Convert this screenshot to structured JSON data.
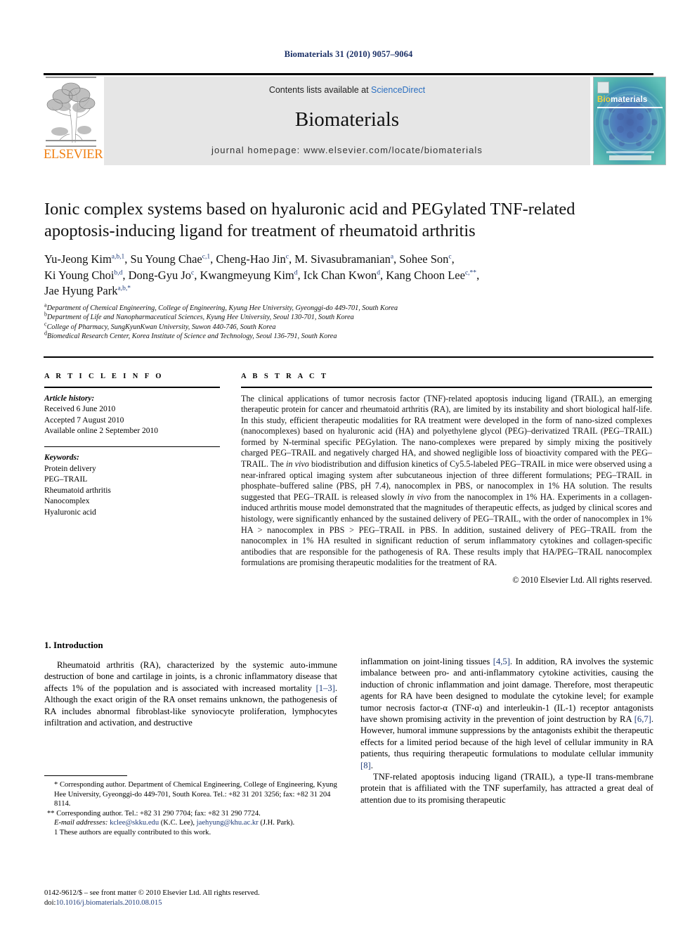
{
  "running_head": "Biomaterials 31 (2010) 9057–9064",
  "masthead": {
    "publisher_name": "ELSEVIER",
    "contents_prefix": "Contents lists available at ",
    "contents_link": "ScienceDirect",
    "journal_name": "Biomaterials",
    "homepage": "journal homepage: www.elsevier.com/locate/biomaterials",
    "cover": {
      "brand_bio": "Bio",
      "brand_materials": "materials"
    }
  },
  "article": {
    "title": "Ionic complex systems based on hyaluronic acid and PEGylated TNF-related apoptosis-inducing ligand for treatment of rheumatoid arthritis",
    "authors_line_1": "Yu-Jeong Kim a,b,1, Su Young Chae c,1, Cheng-Hao Jin c, M. Sivasubramanian a, Sohee Son c,",
    "authors_line_2": "Ki Young Choi b,d, Dong-Gyu Jo c, Kwangmeyung Kim d, Ick Chan Kwon d, Kang Choon Lee c,**,",
    "authors_line_3": "Jae Hyung Park a,b,*",
    "affiliations": [
      {
        "mark": "a",
        "text": "Department of Chemical Engineering, College of Engineering, Kyung Hee University, Gyeonggi-do 449-701, South Korea"
      },
      {
        "mark": "b",
        "text": "Department of Life and Nanopharmaceutical Sciences, Kyung Hee University, Seoul 130-701, South Korea"
      },
      {
        "mark": "c",
        "text": "College of Pharmacy, SungKyunKwan University, Suwon 440-746, South Korea"
      },
      {
        "mark": "d",
        "text": "Biomedical Research Center, Korea Institute of Science and Technology, Seoul 136-791, South Korea"
      }
    ]
  },
  "article_info": {
    "heading": "A R T I C L E  I N F O",
    "history_label": "Article history:",
    "history": [
      "Received 6 June 2010",
      "Accepted 7 August 2010",
      "Available online 2 September 2010"
    ],
    "keywords_label": "Keywords:",
    "keywords": [
      "Protein delivery",
      "PEG–TRAIL",
      "Rheumatoid arthritis",
      "Nanocomplex",
      "Hyaluronic acid"
    ]
  },
  "abstract": {
    "heading": "A B S T R A C T",
    "paragraph_1": "The clinical applications of tumor necrosis factor (TNF)-related apoptosis inducing ligand (TRAIL), an emerging therapeutic protein for cancer and rheumatoid arthritis (RA), are limited by its instability and short biological half-life. In this study, efficient therapeutic modalities for RA treatment were developed in the form of nano-sized complexes (nanocomplexes) based on hyaluronic acid (HA) and polyethylene glycol (PEG)–derivatized TRAIL (PEG–TRAIL) formed by N-terminal specific PEGylation. The nano-complexes were prepared by simply mixing the positively charged PEG–TRAIL and negatively charged HA, and showed negligible loss of bioactivity compared with the PEG–TRAIL. The ",
    "italic_1": "in vivo",
    "paragraph_2": " biodistribution and diffusion kinetics of Cy5.5-labeled PEG–TRAIL in mice were observed using a near-infrared optical imaging system after subcutaneous injection of three different formulations; PEG–TRAIL in phosphate–buffered saline (PBS, pH 7.4), nanocomplex in PBS, or nanocomplex in 1% HA solution. The results suggested that PEG–TRAIL is released slowly ",
    "italic_2": "in vivo",
    "paragraph_3": " from the nanocomplex in 1% HA. Experiments in a collagen-induced arthritis mouse model demonstrated that the magnitudes of therapeutic effects, as judged by clinical scores and histology, were significantly enhanced by the sustained delivery of PEG–TRAIL, with the order of nanocomplex in 1% HA > nanocomplex in PBS > PEG–TRAIL in PBS. In addition, sustained delivery of PEG–TRAIL from the nanocomplex in 1% HA resulted in significant reduction of serum inflammatory cytokines and collagen-specific antibodies that are responsible for the pathogenesis of RA. These results imply that HA/PEG–TRAIL nanocomplex formulations are promising therapeutic modalities for the treatment of RA.",
    "copyright": "© 2010 Elsevier Ltd. All rights reserved."
  },
  "introduction": {
    "heading": "1.  Introduction",
    "left_part_1": "Rheumatoid arthritis (RA), characterized by the systemic auto-immune destruction of bone and cartilage in joints, is a chronic inflammatory disease that affects 1% of the population and is associated with increased mortality ",
    "left_ref_1": "[1–3]",
    "left_part_2": ". Although the exact origin of the RA onset remains unknown, the pathogenesis of RA includes abnormal fibroblast-like synoviocyte proliferation, lymphocytes infiltration and activation, and destructive",
    "right_part_1": "inflammation on joint-lining tissues ",
    "right_ref_1": "[4,5]",
    "right_part_2": ". In addition, RA involves the systemic imbalance between pro- and anti-inflammatory cytokine activities, causing the induction of chronic inflammation and joint damage. Therefore, most therapeutic agents for RA have been designed to modulate the cytokine level; for example tumor necrosis factor-α (TNF-α) and interleukin-1 (IL-1) receptor antagonists have shown promising activity in the prevention of joint destruction by RA ",
    "right_ref_2": "[6,7]",
    "right_part_3": ". However, humoral immune suppressions by the antagonists exhibit the therapeutic effects for a limited period because of the high level of cellular immunity in RA patients, thus requiring therapeutic formulations to modulate cellular immunity ",
    "right_ref_3": "[8]",
    "right_part_4": ".",
    "right_para2": "TNF-related apoptosis inducing ligand (TRAIL), a type-II trans-membrane protein that is affiliated with the TNF superfamily, has attracted a great deal of attention due to its promising therapeutic"
  },
  "footnotes": {
    "note_star": "* Corresponding author. Department of Chemical Engineering, College of Engineering, Kyung Hee University, Gyeonggi-do 449-701, South Korea. Tel.: +82 31 201 3256; fax: +82 31 204 8114.",
    "note_dstar": "** Corresponding author. Tel.: +82 31 290 7704; fax: +82 31 290 7724.",
    "email_label": "E-mail addresses:",
    "email_1": "kclee@skku.edu",
    "email_1_name": " (K.C. Lee), ",
    "email_2": "jaehyung@khu.ac.kr",
    "email_2_name": " (J.H. Park).",
    "note_1": "1  These authors are equally contributed to this work."
  },
  "imprint": {
    "line_1": "0142-9612/$ – see front matter © 2010 Elsevier Ltd. All rights reserved.",
    "doi_label": "doi:",
    "doi_value": "10.1016/j.biomaterials.2010.08.015"
  },
  "colors": {
    "link_blue": "#2b6fc1",
    "ref_navy": "#1f3c7a",
    "elsevier_orange": "#f07f12",
    "band_gray": "#e6e6e6",
    "cover_teal": "#4aa9ac"
  }
}
